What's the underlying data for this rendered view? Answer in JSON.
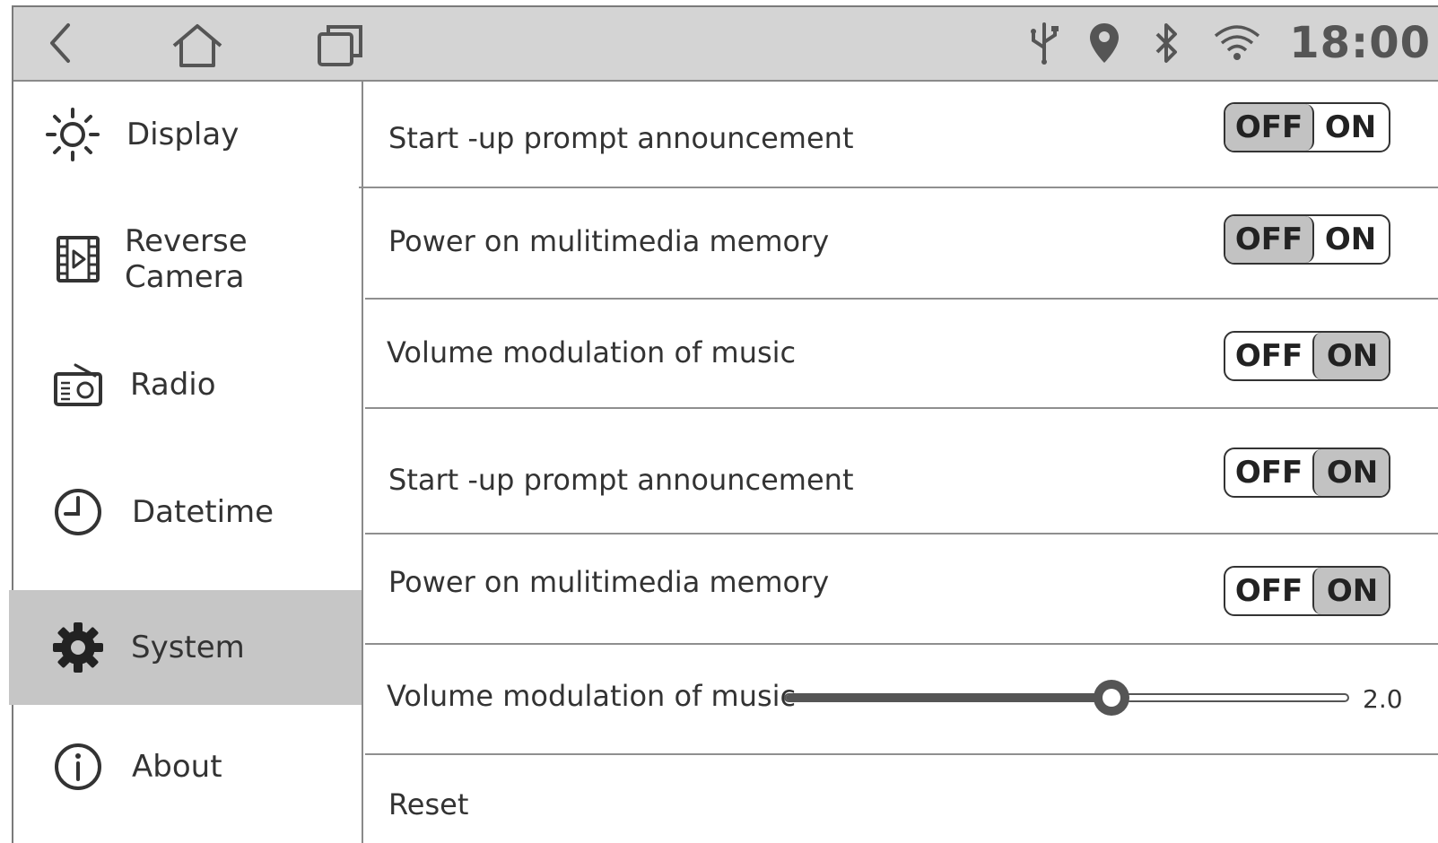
{
  "status_bar": {
    "icons": [
      "back-icon",
      "home-icon",
      "recents-icon",
      "usb-icon",
      "location-icon",
      "bluetooth-icon",
      "wifi-icon"
    ],
    "time": "18:00"
  },
  "sidebar": {
    "items": [
      {
        "label": "Display",
        "icon": "brightness-icon",
        "active": false
      },
      {
        "label": "Reverse Camera",
        "icon": "video-file-icon",
        "active": false
      },
      {
        "label": "Radio",
        "icon": "radio-icon",
        "active": false
      },
      {
        "label": "Datetime",
        "icon": "clock-icon",
        "active": false
      },
      {
        "label": "System",
        "icon": "gear-icon",
        "active": true
      },
      {
        "label": "About",
        "icon": "info-icon",
        "active": false
      }
    ]
  },
  "settings": {
    "rows": [
      {
        "label": "Start -up prompt announcement",
        "type": "toggle",
        "off_label": "OFF",
        "on_label": "ON",
        "value": "OFF"
      },
      {
        "label": "Power on mulitimedia memory",
        "type": "toggle",
        "off_label": "OFF",
        "on_label": "ON",
        "value": "OFF"
      },
      {
        "label": "Volume modulation of music",
        "type": "toggle",
        "off_label": "OFF",
        "on_label": "ON",
        "value": "ON"
      },
      {
        "label": "Start -up prompt announcement",
        "type": "toggle",
        "off_label": "OFF",
        "on_label": "ON",
        "value": "ON"
      },
      {
        "label": "Power on mulitimedia memory",
        "type": "toggle",
        "off_label": "OFF",
        "on_label": "ON",
        "value": "ON"
      },
      {
        "label": "Volume modulation of music",
        "type": "slider",
        "value_label": "2.0",
        "fraction": 0.58
      },
      {
        "label": "Reset",
        "type": "action"
      }
    ]
  },
  "colors": {
    "status_bar_bg": "#d4d4d4",
    "active_item_bg": "#c6c6c6",
    "toggle_selected_bg": "#c2c2c2",
    "text": "#333333"
  }
}
